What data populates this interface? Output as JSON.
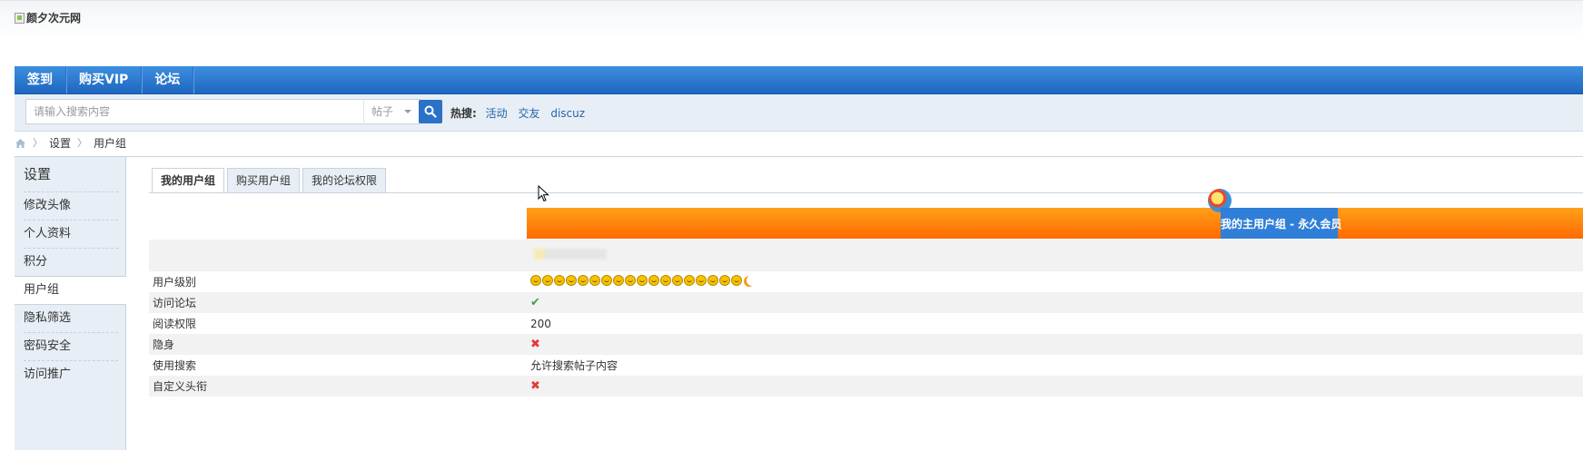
{
  "site": {
    "logo_alt": "颜夕次元网"
  },
  "nav": {
    "items": [
      "签到",
      "购买VIP",
      "论坛"
    ]
  },
  "search": {
    "placeholder": "请输入搜索内容",
    "type_selected": "帖子",
    "hot_label": "热搜:",
    "hot_links": [
      "活动",
      "交友",
      "discuz"
    ]
  },
  "breadcrumb": {
    "items": [
      "设置",
      "用户组"
    ]
  },
  "sidebar": {
    "title": "设置",
    "items": [
      "修改头像",
      "个人资料",
      "积分",
      "用户组",
      "隐私筛选",
      "密码安全",
      "访问推广"
    ],
    "active_index": 3
  },
  "tabs": {
    "items": [
      "我的用户组",
      "购买用户组",
      "我的论坛权限"
    ],
    "active_index": 0
  },
  "group": {
    "badge": "我的主用户组 - 永久会员"
  },
  "permissions": [
    {
      "label": "用户级别",
      "value_type": "level-icons",
      "face_count": 18
    },
    {
      "label": "访问论坛",
      "value_type": "check"
    },
    {
      "label": "阅读权限",
      "value": "200"
    },
    {
      "label": "隐身",
      "value_type": "cross"
    },
    {
      "label": "使用搜索",
      "value": "允许搜索帖子内容"
    },
    {
      "label": "自定义头衔",
      "value_type": "cross"
    }
  ],
  "icons": {
    "check": "✔",
    "cross": "✖",
    "home": "home-icon",
    "search": "search-icon"
  },
  "colors": {
    "nav_blue": "#1e66bf",
    "orange": "#ff6a00",
    "badge_blue": "#2f7fd8",
    "link": "#2366a8"
  }
}
